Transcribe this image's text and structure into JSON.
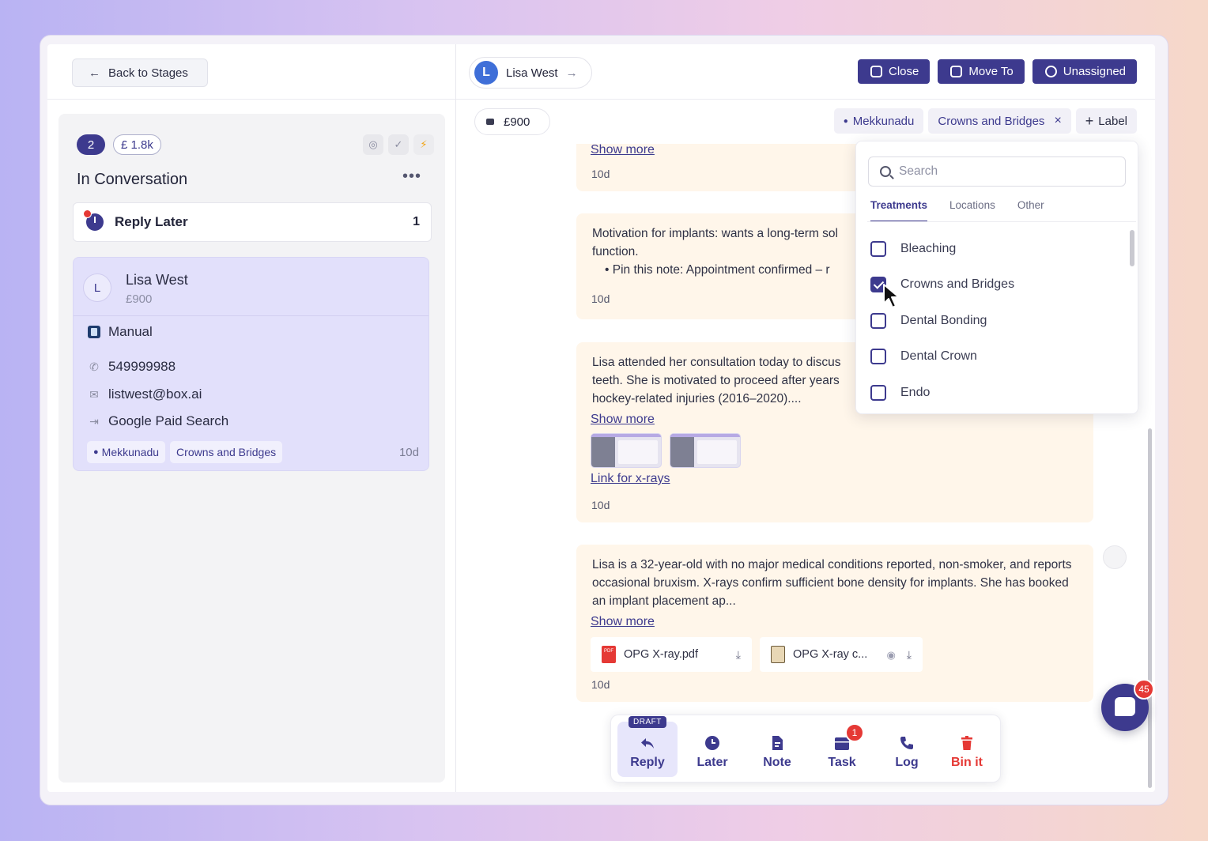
{
  "left": {
    "back_label": "Back to Stages",
    "stage": {
      "count": "2",
      "value": "£ 1.8k",
      "title": "In Conversation",
      "more": "•••"
    },
    "reply_later": {
      "label": "Reply Later",
      "count": "1"
    },
    "lead": {
      "initial": "L",
      "name": "Lisa West",
      "value": "£900",
      "source_type": "Manual",
      "phone": "549999988",
      "email": "listwest@box.ai",
      "channel": "Google Paid Search",
      "tags": [
        "Mekkunadu",
        "Crowns and Bridges"
      ],
      "age": "10d"
    }
  },
  "header": {
    "contact": {
      "initial": "L",
      "name": "Lisa West"
    },
    "buttons": {
      "close": "Close",
      "move_to": "Move To",
      "assign": "Unassigned"
    }
  },
  "labels_bar": {
    "price": "£900",
    "chips": {
      "location": "Mekkunadu",
      "treatment": "Crowns and Bridges",
      "add": "Label"
    }
  },
  "feed": {
    "msg1": {
      "show_more": "Show more",
      "time": "10d"
    },
    "msg2": {
      "line1": "Motivation for implants: wants a long-term sol",
      "line2": "function.",
      "bullet": "Pin this note: Appointment confirmed – r",
      "time": "10d"
    },
    "msg3": {
      "line1": "Lisa attended her consultation today to discus",
      "line2": "teeth. She is motivated to proceed after years",
      "line3": "hockey-related injuries (2016–2020)....",
      "show_more": "Show more",
      "link": "Link for x-rays",
      "time": "10d"
    },
    "msg4": {
      "text": "Lisa is a 32-year-old with no major medical conditions reported, non-smoker, and reports occasional bruxism. X-rays confirm sufficient bone density for implants. She has booked an implant placement ap...",
      "show_more": "Show more",
      "files": [
        "OPG X-ray.pdf",
        "OPG X-ray c..."
      ],
      "time": "10d"
    }
  },
  "dropdown": {
    "search_placeholder": "Search",
    "tabs": [
      "Treatments",
      "Locations",
      "Other"
    ],
    "items": [
      {
        "label": "Bleaching",
        "checked": false
      },
      {
        "label": "Crowns and Bridges",
        "checked": true
      },
      {
        "label": "Dental Bonding",
        "checked": false
      },
      {
        "label": "Dental Crown",
        "checked": false
      },
      {
        "label": "Endo",
        "checked": false
      }
    ]
  },
  "actions": {
    "draft": "DRAFT",
    "reply": "Reply",
    "later": "Later",
    "note": "Note",
    "task": "Task",
    "task_badge": "1",
    "log": "Log",
    "bin": "Bin it"
  },
  "chat": {
    "badge": "45"
  },
  "colors": {
    "accent": "#3d3a8e",
    "danger": "#e53935",
    "note_bg": "#fff6ea",
    "card_bg": "#e2e0fb"
  }
}
